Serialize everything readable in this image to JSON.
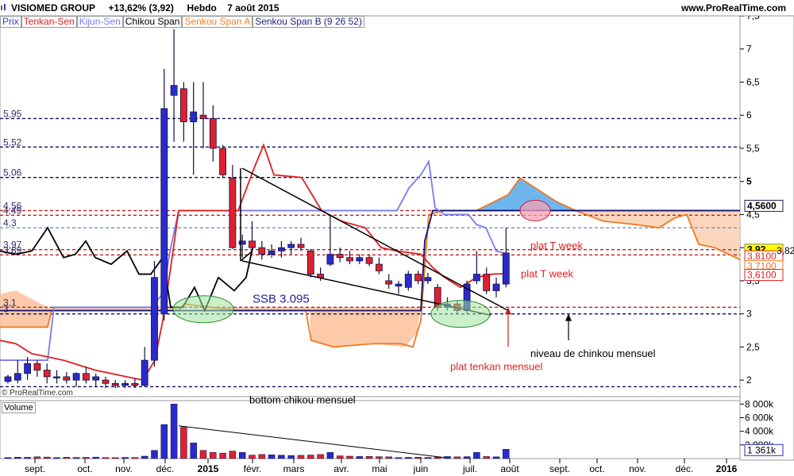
{
  "header": {
    "title": "VISIOMED GROUP",
    "change": "+13,62% (3,92)",
    "period": "Hebdo",
    "date": "7 août 2015",
    "site": "www.ProRealTime.com"
  },
  "legend": {
    "items": [
      {
        "label": "Prix",
        "color": "#3a3ad0"
      },
      {
        "label": "Tenkan-Sen",
        "color": "#e02020"
      },
      {
        "label": "Kijun-Sen",
        "color": "#7b7bf0"
      },
      {
        "label": "Chikou Span",
        "color": "#000000"
      },
      {
        "label": "Senkou Span A",
        "color": "#f08030"
      },
      {
        "label": "Senkou Span B (9 26 52)",
        "color": "#202080"
      }
    ]
  },
  "copyright": "© ProRealTime.com",
  "volume_panel": {
    "label": "Volume",
    "ticks": [
      "8 000k",
      "6 000k",
      "4 000k",
      "2 000k"
    ],
    "current_label": "1 361k"
  },
  "chart_data": {
    "type": "candlestick",
    "x_ticks": [
      "sept.",
      "oct.",
      "nov.",
      "déc.",
      "2015",
      "févr.",
      "mars",
      "avr.",
      "mai",
      "juin",
      "juil.",
      "août",
      "sept.",
      "oct.",
      "nov.",
      "déc.",
      "2016"
    ],
    "y_ticks": [
      "7,5",
      "7",
      "6,5",
      "6",
      "5,5",
      "5",
      "4,5",
      "4",
      "3,5",
      "3",
      "2,5",
      "2"
    ],
    "ylim": [
      1.75,
      7.5
    ],
    "left_levels": [
      "5,95",
      "5,52",
      "5,06",
      "4,56",
      "4,49",
      "4,3",
      "3,97",
      "3,89",
      "3,1",
      "3"
    ],
    "right_labels": [
      "4,5600",
      "3,92",
      "3,8100",
      "3,7100",
      "3,6100",
      "3,82"
    ],
    "candles": [
      {
        "o": 1.98,
        "h": 2.08,
        "l": 1.95,
        "c": 2.05
      },
      {
        "o": 2.0,
        "h": 2.3,
        "l": 1.95,
        "c": 2.1
      },
      {
        "o": 2.1,
        "h": 2.35,
        "l": 2.0,
        "c": 2.25
      },
      {
        "o": 2.25,
        "h": 2.3,
        "l": 2.05,
        "c": 2.15
      },
      {
        "o": 2.15,
        "h": 2.25,
        "l": 1.95,
        "c": 2.05
      },
      {
        "o": 2.05,
        "h": 2.15,
        "l": 1.95,
        "c": 2.05
      },
      {
        "o": 2.05,
        "h": 2.12,
        "l": 1.95,
        "c": 2.0
      },
      {
        "o": 2.0,
        "h": 2.12,
        "l": 1.9,
        "c": 2.1
      },
      {
        "o": 2.1,
        "h": 2.2,
        "l": 1.95,
        "c": 2.0
      },
      {
        "o": 2.0,
        "h": 2.1,
        "l": 1.9,
        "c": 2.05
      },
      {
        "o": 2.0,
        "h": 2.05,
        "l": 1.88,
        "c": 1.95
      },
      {
        "o": 1.95,
        "h": 2.0,
        "l": 1.88,
        "c": 1.92
      },
      {
        "o": 1.92,
        "h": 2.0,
        "l": 1.88,
        "c": 1.95
      },
      {
        "o": 1.95,
        "h": 2.02,
        "l": 1.88,
        "c": 1.92
      },
      {
        "o": 1.92,
        "h": 2.5,
        "l": 1.9,
        "c": 2.3
      },
      {
        "o": 2.3,
        "h": 3.8,
        "l": 2.2,
        "c": 3.55
      },
      {
        "o": 3.0,
        "h": 6.7,
        "l": 2.9,
        "c": 6.1
      },
      {
        "o": 6.3,
        "h": 7.3,
        "l": 5.6,
        "c": 6.45
      },
      {
        "o": 6.4,
        "h": 6.5,
        "l": 5.6,
        "c": 5.9
      },
      {
        "o": 5.9,
        "h": 6.5,
        "l": 5.1,
        "c": 6.05
      },
      {
        "o": 6.0,
        "h": 6.5,
        "l": 5.5,
        "c": 5.95
      },
      {
        "o": 5.95,
        "h": 6.15,
        "l": 5.3,
        "c": 5.5
      },
      {
        "o": 5.5,
        "h": 5.55,
        "l": 5.05,
        "c": 5.1
      },
      {
        "o": 5.05,
        "h": 5.25,
        "l": 3.98,
        "c": 4.0
      },
      {
        "o": 4.05,
        "h": 4.2,
        "l": 3.85,
        "c": 4.1
      },
      {
        "o": 4.1,
        "h": 4.4,
        "l": 3.92,
        "c": 4.0
      },
      {
        "o": 4.0,
        "h": 4.1,
        "l": 3.82,
        "c": 3.9
      },
      {
        "o": 3.9,
        "h": 4.05,
        "l": 3.85,
        "c": 3.95
      },
      {
        "o": 3.95,
        "h": 4.1,
        "l": 3.85,
        "c": 4.0
      },
      {
        "o": 4.0,
        "h": 4.1,
        "l": 3.9,
        "c": 4.05
      },
      {
        "o": 4.05,
        "h": 4.15,
        "l": 3.95,
        "c": 4.0
      },
      {
        "o": 3.95,
        "h": 3.98,
        "l": 3.55,
        "c": 3.6
      },
      {
        "o": 3.6,
        "h": 3.7,
        "l": 3.5,
        "c": 3.55
      },
      {
        "o": 3.75,
        "h": 4.5,
        "l": 3.72,
        "c": 3.9
      },
      {
        "o": 3.9,
        "h": 4.0,
        "l": 3.78,
        "c": 3.85
      },
      {
        "o": 3.85,
        "h": 3.95,
        "l": 3.75,
        "c": 3.8
      },
      {
        "o": 3.8,
        "h": 3.9,
        "l": 3.75,
        "c": 3.85
      },
      {
        "o": 3.85,
        "h": 3.9,
        "l": 3.72,
        "c": 3.76
      },
      {
        "o": 3.75,
        "h": 3.85,
        "l": 3.6,
        "c": 3.65
      },
      {
        "o": 3.5,
        "h": 3.6,
        "l": 3.38,
        "c": 3.45
      },
      {
        "o": 3.42,
        "h": 3.5,
        "l": 3.3,
        "c": 3.45
      },
      {
        "o": 3.4,
        "h": 3.65,
        "l": 3.35,
        "c": 3.6
      },
      {
        "o": 3.6,
        "h": 3.65,
        "l": 3.45,
        "c": 3.5
      },
      {
        "o": 3.5,
        "h": 3.62,
        "l": 3.45,
        "c": 3.55
      },
      {
        "o": 3.4,
        "h": 3.45,
        "l": 3.05,
        "c": 3.1
      },
      {
        "o": 3.1,
        "h": 3.25,
        "l": 3.05,
        "c": 3.15
      },
      {
        "o": 3.15,
        "h": 3.2,
        "l": 3.0,
        "c": 3.05
      },
      {
        "o": 3.05,
        "h": 3.5,
        "l": 3.0,
        "c": 3.45
      },
      {
        "o": 3.5,
        "h": 3.95,
        "l": 3.45,
        "c": 3.6
      },
      {
        "o": 3.6,
        "h": 3.7,
        "l": 3.3,
        "c": 3.35
      },
      {
        "o": 3.35,
        "h": 3.55,
        "l": 3.25,
        "c": 3.45
      },
      {
        "o": 3.45,
        "h": 4.3,
        "l": 3.4,
        "c": 3.92
      }
    ],
    "volume": [
      150,
      200,
      180,
      260,
      220,
      140,
      200,
      160,
      180,
      210,
      150,
      130,
      170,
      160,
      350,
      1200,
      5000,
      8000,
      4600,
      2300,
      1200,
      900,
      800,
      1100,
      900,
      500,
      600,
      550,
      500,
      450,
      480,
      520,
      600,
      900,
      400,
      350,
      300,
      320,
      280,
      250,
      150,
      180,
      200,
      160,
      220,
      300,
      250,
      280,
      900,
      300,
      250,
      1361
    ],
    "annotations": [
      "SSB 3.095",
      "plat T week",
      "plat T week",
      "plat tenkan mensuel",
      "niveau de chinkou mensuel",
      "bottom  chikou mensuel"
    ]
  }
}
